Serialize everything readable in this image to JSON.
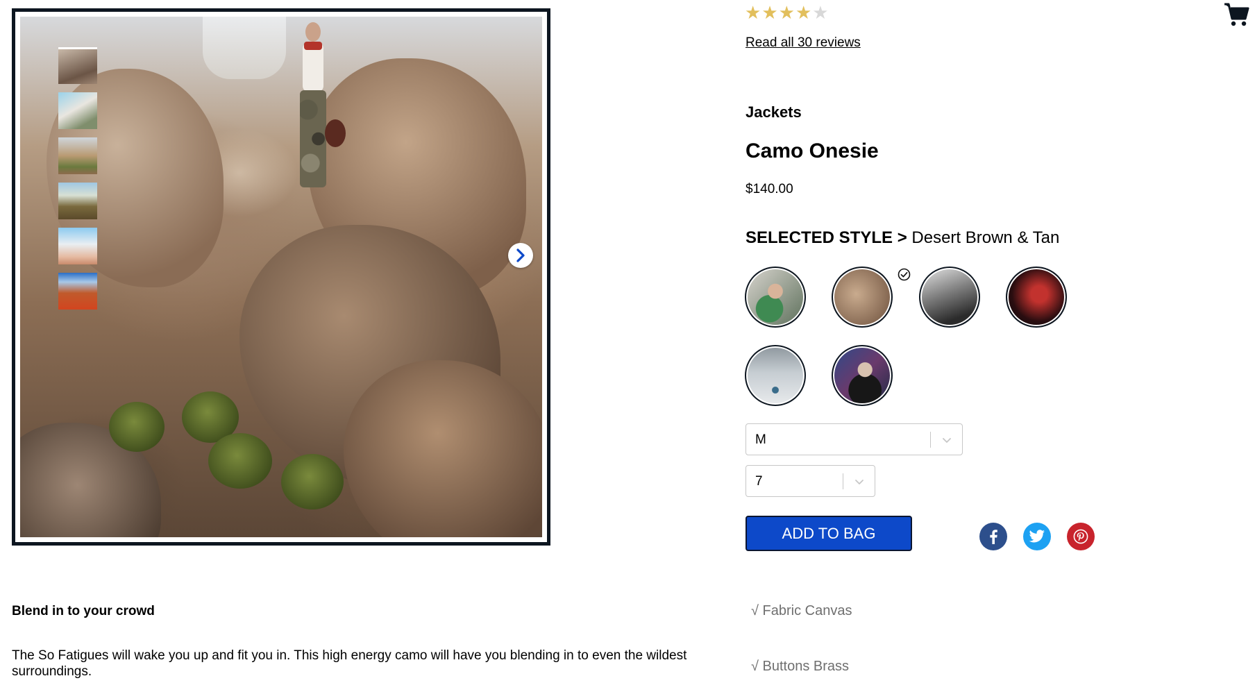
{
  "product": {
    "rating": 4,
    "rating_max": 5,
    "reviews_link": "Read all 30 reviews",
    "category": "Jackets",
    "name": "Camo Onesie",
    "price": "$140.00"
  },
  "style": {
    "label": "SELECTED STYLE >",
    "selected": "Desert Brown & Tan",
    "selected_index": 1,
    "swatch_count": 6
  },
  "size_select": {
    "value": "M"
  },
  "quantity_select": {
    "value": "7"
  },
  "add_to_bag": {
    "label": "ADD TO BAG"
  },
  "social": {
    "icons": [
      "facebook-icon",
      "twitter-icon",
      "pinterest-icon"
    ],
    "colors": [
      "#2d4f8c",
      "#1da1f2",
      "#c8232c"
    ]
  },
  "features": [
    "√ Fabric Canvas",
    "√ Buttons Brass"
  ],
  "description": {
    "title": "Blend in to your crowd",
    "body": "The So Fatigues will wake you up and fit you in. This high energy camo will have you blending in to even the wildest surroundings."
  },
  "gallery": {
    "thumbnail_count": 6
  },
  "colors": {
    "accent": "#0d49c9",
    "star": "#e2bf5c",
    "frame": "#0d1620"
  }
}
